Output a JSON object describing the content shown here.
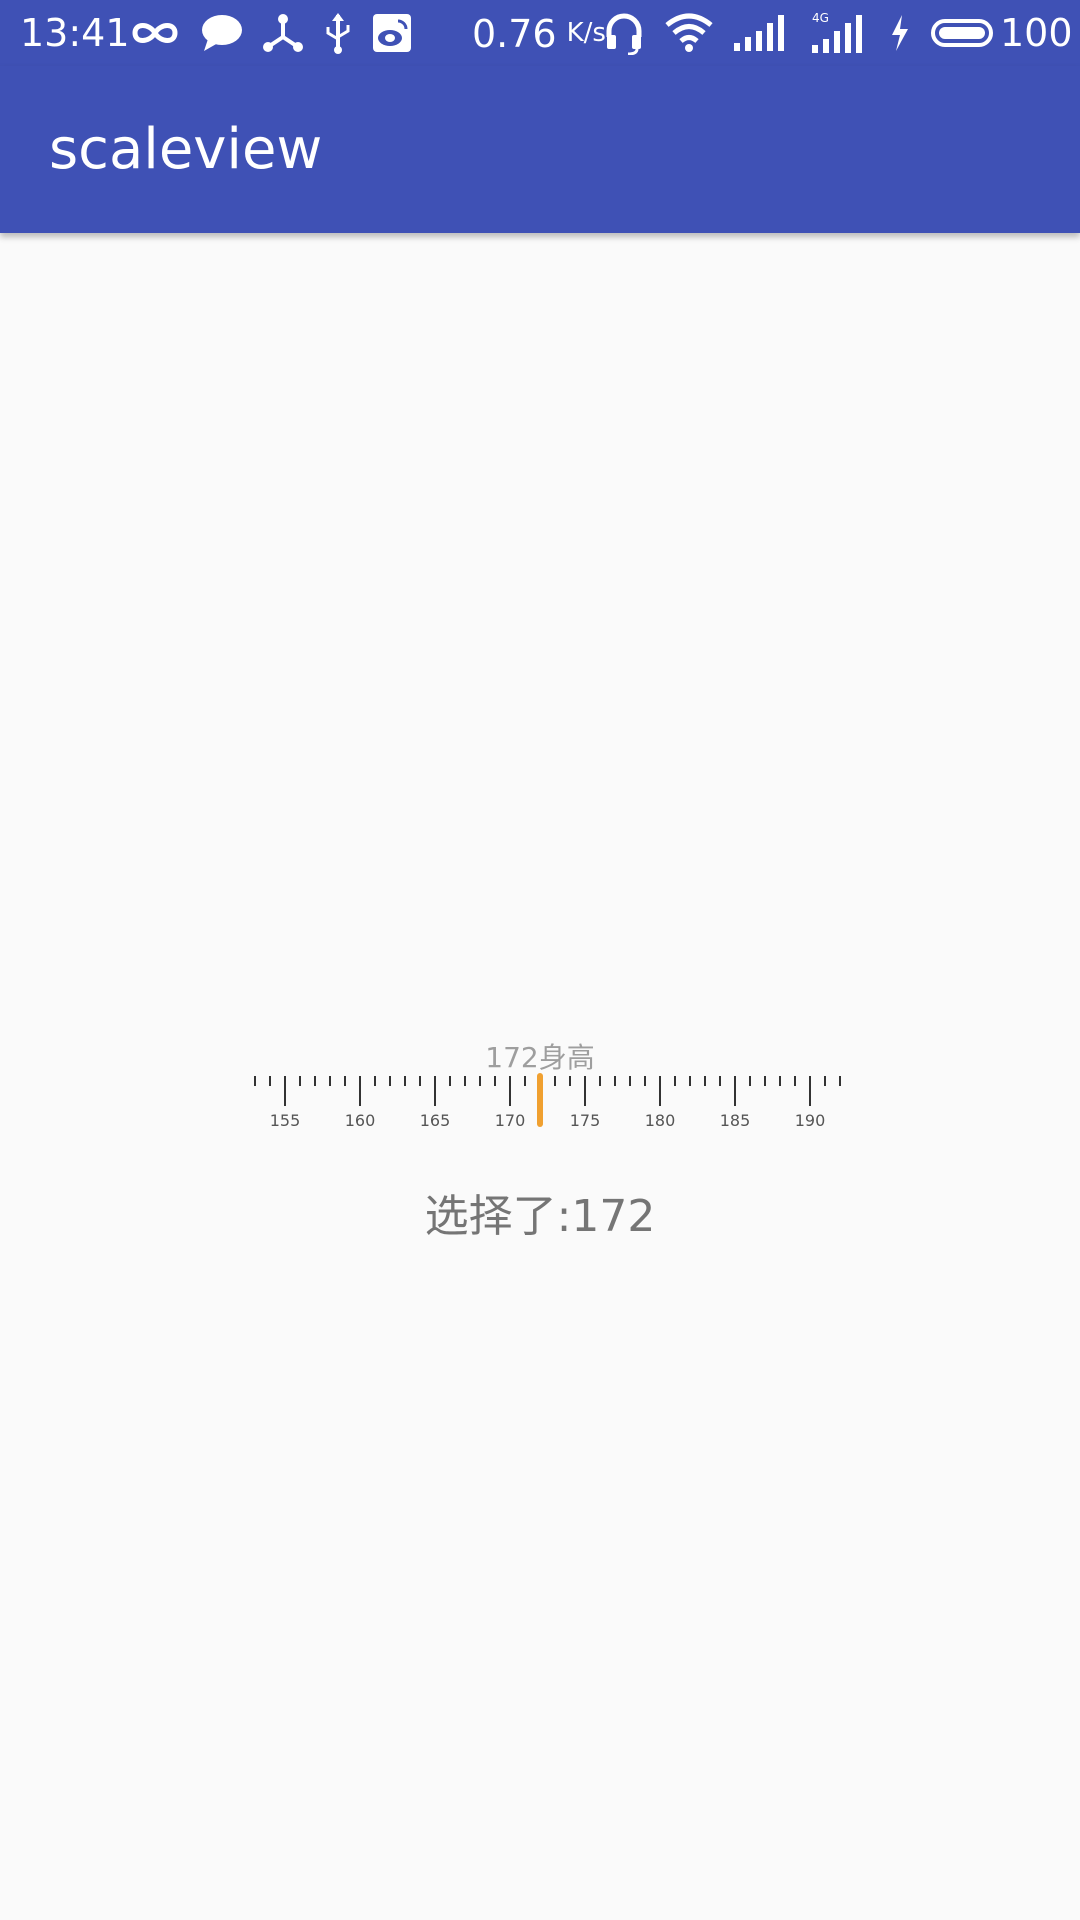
{
  "status_bar": {
    "time": "13:41",
    "net_speed": "0.76",
    "net_speed_unit": "K/s",
    "network_type": "4G",
    "battery_percent": "100",
    "icons": [
      "infinity-icon",
      "chat-icon",
      "share-nodes-icon",
      "usb-icon",
      "weibo-icon",
      "headset-icon",
      "wifi-icon",
      "signal-icon",
      "signal-4g-icon",
      "charging-icon",
      "battery-icon"
    ]
  },
  "app_bar": {
    "title": "scaleview"
  },
  "ruler": {
    "current_value": 172,
    "value_label": "172身高",
    "min_visible": 153,
    "max_visible": 192,
    "major_step": 5,
    "labels": [
      "155",
      "160",
      "165",
      "170",
      "175",
      "180",
      "185",
      "190"
    ],
    "indicator_color": "#f0a030"
  },
  "selection": {
    "text": "选择了:172"
  },
  "colors": {
    "primary": "#3f51b5",
    "background": "#fafafa",
    "accent": "#f0a030"
  }
}
